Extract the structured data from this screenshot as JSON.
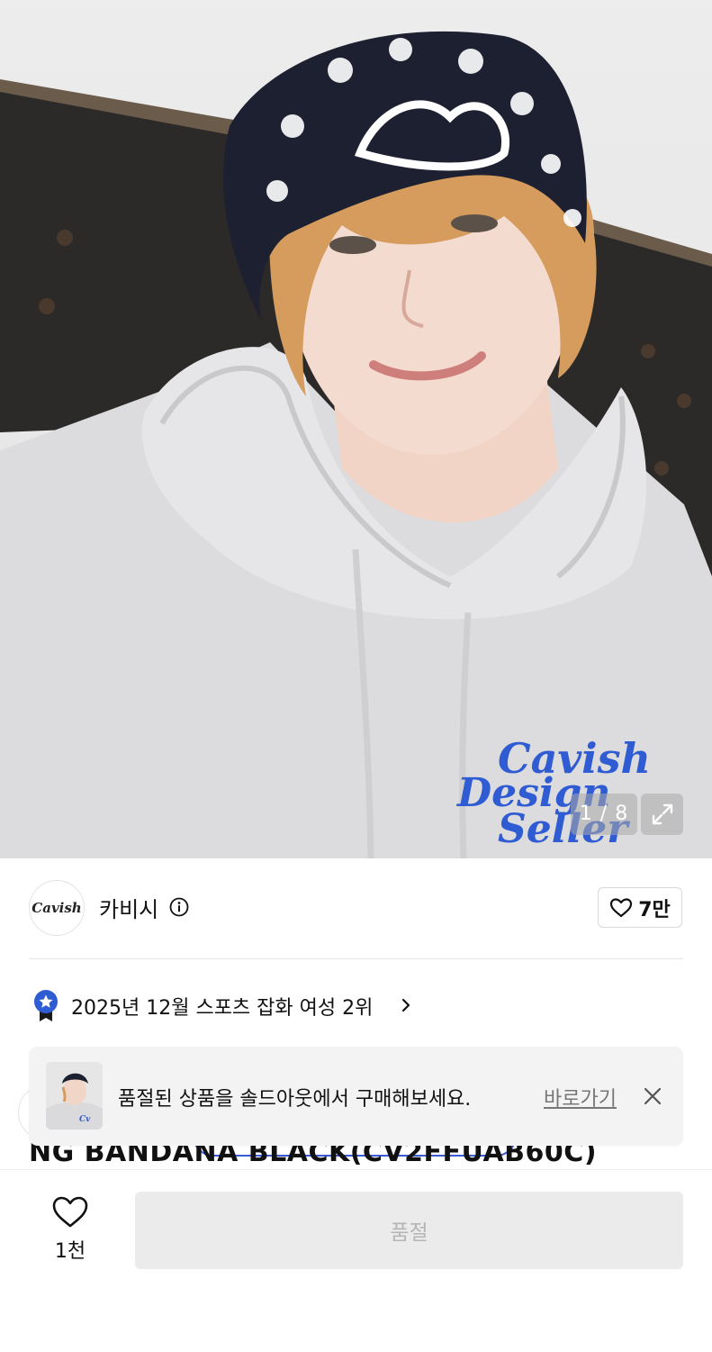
{
  "gallery": {
    "counter": "1 / 8",
    "print_text": [
      "Cavish",
      "Design",
      "Seller"
    ],
    "expand_icon": "expand-icon"
  },
  "brand": {
    "logo_text": "Cavish",
    "name": "카비시",
    "info_icon": "info-icon",
    "like_count": "7만"
  },
  "ranking": {
    "text": "2025년 12월 스포츠 잡화 여성 2위",
    "icon": "medal-star-icon"
  },
  "product": {
    "title_fragment": "NG BANDANA BLACK(CV2FFUAB60C)"
  },
  "toast": {
    "message": "품절된 상품을 솔드아웃에서 구매해보세요.",
    "link": "바로가기",
    "close_icon": "close-icon"
  },
  "bottom": {
    "wish_count": "1천",
    "buy_label": "품절"
  },
  "colors": {
    "accent_blue": "#2f5bd3",
    "sold_out_bg": "#ebebeb",
    "sold_out_text": "#b5b5b5"
  }
}
